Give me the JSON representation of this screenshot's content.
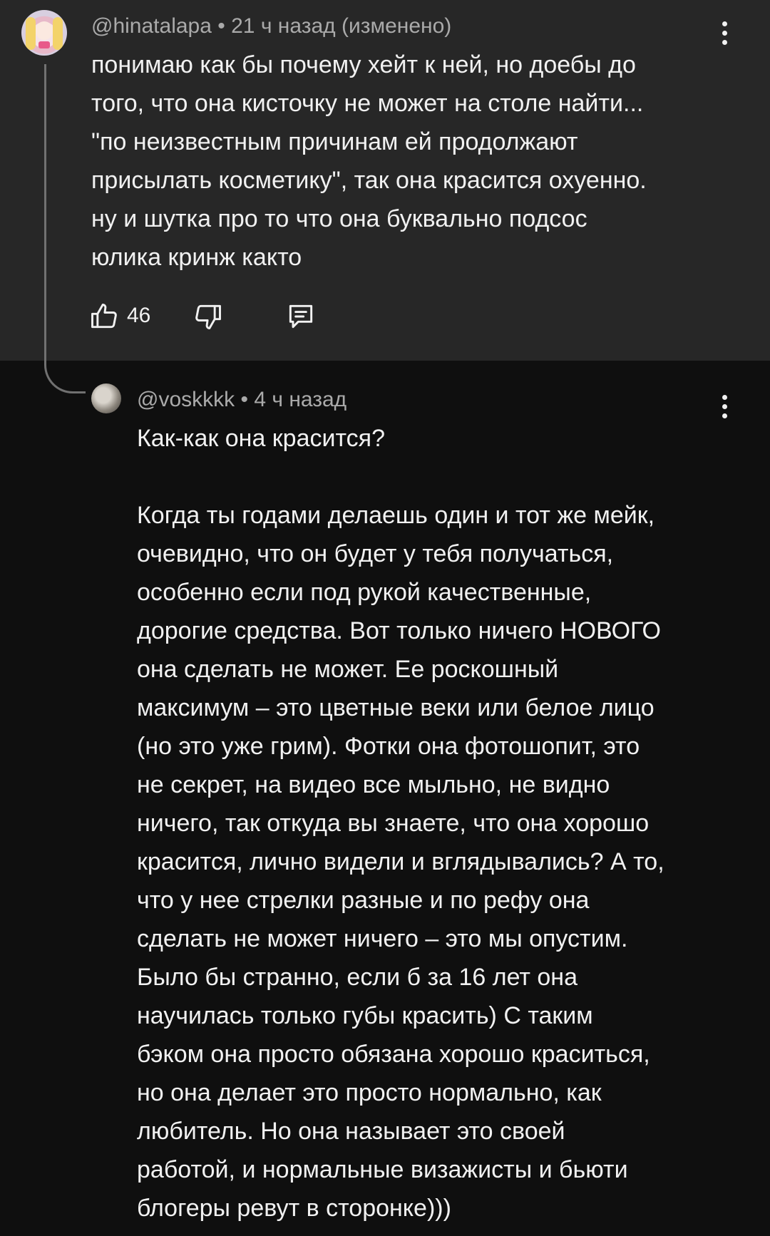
{
  "comment": {
    "author": "@hinatalapa",
    "time": "21 ч назад (изменено)",
    "text": "понимаю как бы почему хейт к ней, но доебы до\nтого, что она кисточку не может на столе найти...\n\"по неизвестным причинам ей продолжают\nприсылать косметику\", так она красится охуенно.\nну и шутка про то что она буквально подсос\nюлика кринж както",
    "likes": "46",
    "icons": {
      "like": "thumb-up-icon",
      "dislike": "thumb-down-icon",
      "reply": "comment-reply-icon",
      "menu": "more-vert-icon"
    }
  },
  "reply": {
    "author": "@voskkkk",
    "time": "4 ч назад",
    "text": "Как-как она красится?\n\nКогда ты годами делаешь один и тот же мейк,\nочевидно, что он будет у тебя получаться,\nособенно если под рукой качественные,\nдорогие средства. Вот только ничего НОВОГО\nона сделать не может. Ее роскошный\nмаксимум – это цветные веки или белое лицо\n(но это уже грим). Фотки она фотошопит, это\nне секрет, на видео все мыльно, не видно\nничего, так откуда вы знаете, что она хорошо\nкрасится, лично видели и вглядывались? А то,\nчто у нее стрелки разные и по рефу она\nсделать не может ничего – это мы опустим.\nБыло бы странно, если б за 16 лет она\nнаучилась только губы красить) С таким\nбэком она просто обязана хорошо краситься,\nно она делает это просто нормально, как\nлюбитель. Но она называет это своей\nработой, и нормальные визажисты и бьюти\nблогеры ревут в сторонке)))"
  },
  "colors": {
    "background": "#0f0f0f",
    "highlight": "#272727",
    "text": "#f1f1f1",
    "meta": "#aaaaaa",
    "thread_line": "#717171"
  }
}
